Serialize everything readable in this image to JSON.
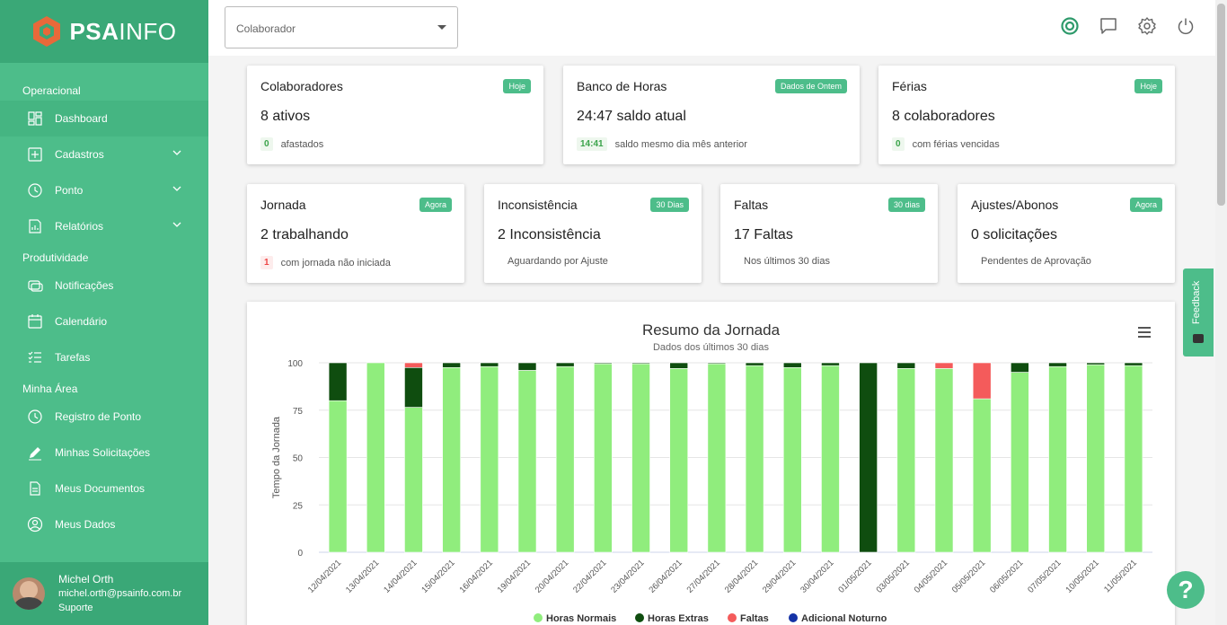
{
  "brand": {
    "name_bold": "PSA",
    "name_light": "INFO"
  },
  "sidebar": {
    "sections": [
      {
        "label": "Operacional",
        "items": [
          {
            "label": "Dashboard",
            "icon": "dashboard-icon",
            "active": true
          },
          {
            "label": "Cadastros",
            "icon": "plus-square-icon",
            "chevron": true
          },
          {
            "label": "Ponto",
            "icon": "clock-icon",
            "chevron": true
          },
          {
            "label": "Relatórios",
            "icon": "report-icon",
            "chevron": true
          }
        ]
      },
      {
        "label": "Produtividade",
        "items": [
          {
            "label": "Notificações",
            "icon": "notification-icon"
          },
          {
            "label": "Calendário",
            "icon": "calendar-icon"
          },
          {
            "label": "Tarefas",
            "icon": "tasks-icon"
          }
        ]
      },
      {
        "label": "Minha Área",
        "items": [
          {
            "label": "Registro de Ponto",
            "icon": "clock-icon"
          },
          {
            "label": "Minhas Solicitações",
            "icon": "pen-icon"
          },
          {
            "label": "Meus Documentos",
            "icon": "document-icon"
          },
          {
            "label": "Meus Dados",
            "icon": "user-circle-icon"
          }
        ]
      }
    ],
    "user": {
      "name": "Michel Orth",
      "email": "michel.orth@psainfo.com.br",
      "role": "Suporte"
    }
  },
  "topbar": {
    "select_placeholder": "Colaborador",
    "icons": [
      "target-icon",
      "chat-icon",
      "settings-icon",
      "power-icon"
    ]
  },
  "cards_row1": [
    {
      "title": "Colaboradores",
      "badge": "Hoje",
      "value": "8 ativos",
      "chip": "0",
      "chip_color": "green",
      "foot": "afastados"
    },
    {
      "title": "Banco de Horas",
      "badge": "Dados de Ontem",
      "value": "24:47 saldo atual",
      "chip": "14:41",
      "chip_color": "green",
      "foot": "saldo mesmo dia mês anterior"
    },
    {
      "title": "Férias",
      "badge": "Hoje",
      "value": "8 colaboradores",
      "chip": "0",
      "chip_color": "green",
      "foot": "com férias vencidas"
    }
  ],
  "cards_row2": [
    {
      "title": "Jornada",
      "badge": "Agora",
      "value": "2 trabalhando",
      "chip": "1",
      "chip_color": "red",
      "foot": "com jornada não iniciada"
    },
    {
      "title": "Inconsistência",
      "badge": "30 Dias",
      "value": "2 Inconsistência",
      "chip": "",
      "foot": "Aguardando por Ajuste"
    },
    {
      "title": "Faltas",
      "badge": "30 dias",
      "value": "17 Faltas",
      "chip": "",
      "foot": "Nos últimos 30 dias"
    },
    {
      "title": "Ajustes/Abonos",
      "badge": "Agora",
      "value": "0 solicitações",
      "chip": "",
      "foot": "Pendentes de Aprovação"
    }
  ],
  "feedback_label": "Feedback",
  "help_label": "?",
  "chart_data": {
    "type": "bar",
    "stacked": true,
    "title": "Resumo da Jornada",
    "subtitle": "Dados dos últimos 30 dias",
    "ylabel": "Tempo da Jornada",
    "ylim": [
      0,
      100
    ],
    "yticks": [
      0,
      25,
      50,
      75,
      100
    ],
    "categories": [
      "12/04/2021",
      "13/04/2021",
      "14/04/2021",
      "15/04/2021",
      "16/04/2021",
      "19/04/2021",
      "20/04/2021",
      "22/04/2021",
      "23/04/2021",
      "26/04/2021",
      "27/04/2021",
      "28/04/2021",
      "29/04/2021",
      "30/04/2021",
      "01/05/2021",
      "03/05/2021",
      "04/05/2021",
      "05/05/2021",
      "06/05/2021",
      "07/05/2021",
      "10/05/2021",
      "11/05/2021"
    ],
    "series": [
      {
        "name": "Horas Normais",
        "color": "#90ed7d",
        "values": [
          80,
          100,
          76.5,
          97.5,
          98,
          96,
          98,
          99.5,
          99.5,
          97,
          99.5,
          98.5,
          97.5,
          98.5,
          0,
          97,
          97,
          81,
          95,
          98,
          99,
          98.5
        ]
      },
      {
        "name": "Horas Extras",
        "color": "#0f4d0f",
        "values": [
          20,
          0,
          21,
          2.5,
          2,
          4,
          2,
          0.5,
          0.5,
          3,
          0.5,
          1.5,
          2.5,
          1.5,
          100,
          3,
          0,
          0,
          5,
          2,
          1,
          1.5
        ]
      },
      {
        "name": "Faltas",
        "color": "#f45b5b",
        "values": [
          0,
          0,
          2.5,
          0,
          0,
          0,
          0,
          0,
          0,
          0,
          0,
          0,
          0,
          0,
          0,
          0,
          3,
          19,
          0,
          0,
          0,
          0
        ]
      },
      {
        "name": "Adicional Noturno",
        "color": "#1533a6",
        "values": [
          0,
          0,
          0,
          0,
          0,
          0,
          0,
          0,
          0,
          0,
          0,
          0,
          0,
          0,
          0,
          0,
          0,
          0,
          0,
          0,
          0,
          0
        ]
      }
    ],
    "legend_position": "bottom"
  }
}
